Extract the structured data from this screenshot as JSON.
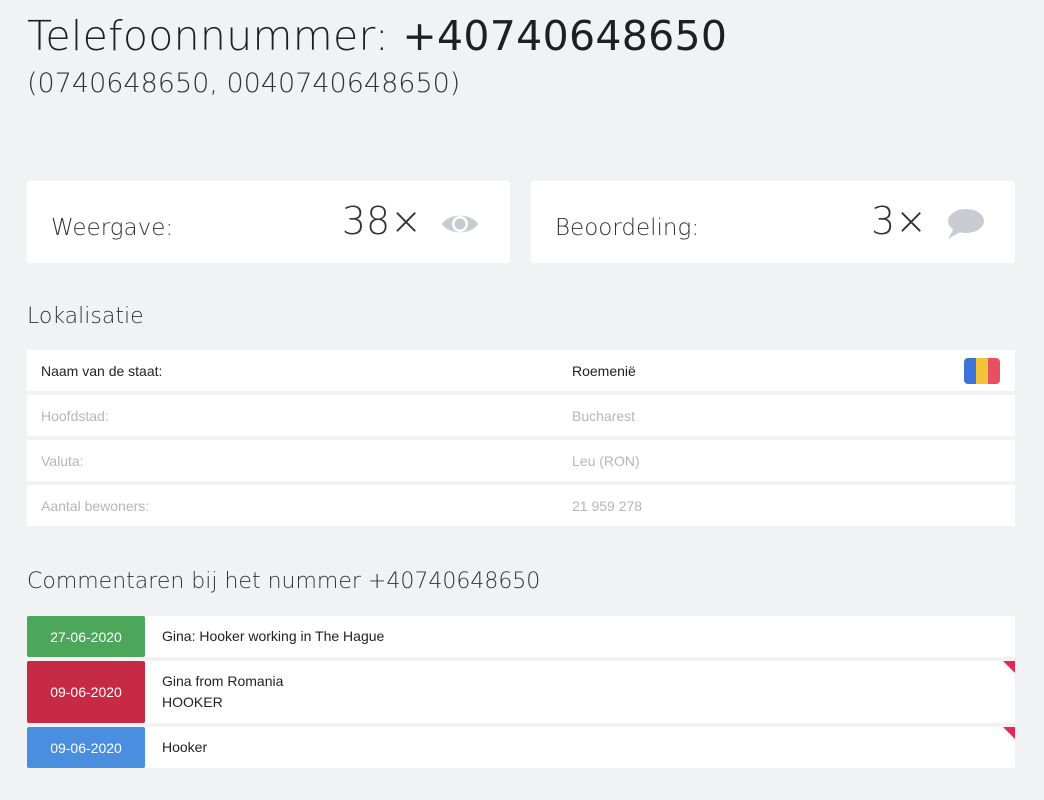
{
  "header": {
    "title_prefix": "Telefoonnummer:",
    "title_number": "+40740648650",
    "subtitle": "(0740648650, 0040740648650)"
  },
  "stats": {
    "views_label": "Weergave:",
    "views_value": "38×",
    "views_icon": "eye-icon",
    "rating_label": "Beoordeling:",
    "rating_value": "3×",
    "rating_icon": "speech-bubble-icon",
    "icon_color": "#c8ccd2"
  },
  "location": {
    "section_title": "Lokalisatie",
    "rows": [
      {
        "label": "Naam van de staat:",
        "value": "Roemenië"
      },
      {
        "label": "Hoofdstad:",
        "value": "Bucharest"
      },
      {
        "label": "Valuta:",
        "value": "Leu (RON)"
      },
      {
        "label": "Aantal bewoners:",
        "value": "21 959 278"
      }
    ],
    "flag_colors": [
      "#3d72d8",
      "#f2c23b",
      "#e8505f"
    ]
  },
  "comments": {
    "section_title": "Commentaren bij het nummer +40740648650",
    "items": [
      {
        "date": "27-06-2020",
        "lines": [
          "Gina: Hooker working in The Hague"
        ],
        "color": "#4ca75a",
        "flagged": false
      },
      {
        "date": "09-06-2020",
        "lines": [
          "Gina from Romania",
          "HOOKER"
        ],
        "color": "#c72a45",
        "flagged": true
      },
      {
        "date": "09-06-2020",
        "lines": [
          "Hooker"
        ],
        "color": "#4a8ee0",
        "flagged": true
      }
    ],
    "flag_color": "#e5265a"
  }
}
